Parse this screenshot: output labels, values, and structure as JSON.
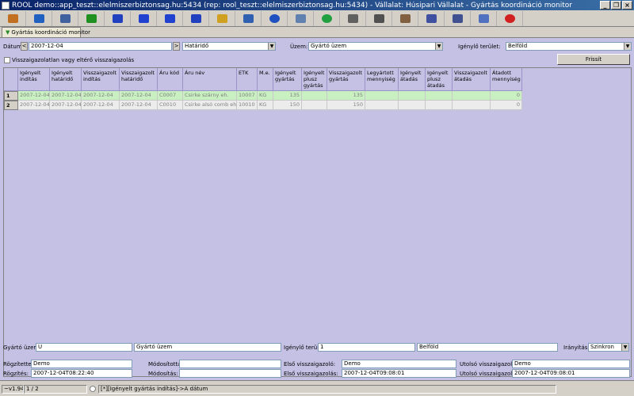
{
  "window": {
    "title": "ROOL demo::app_teszt::elelmiszerbiztonsag.hu:5434 (rep: rool_teszt::elelmiszerbiztonsag.hu:5434) - Vállalat: Húsipari Vállalat - Gyártás koordináció monitor"
  },
  "toolbar": {
    "icons": [
      "edit-icon",
      "open-icon",
      "save-icon",
      "refresh-icon",
      "first-icon",
      "prev-icon",
      "next-icon",
      "last-icon",
      "note-icon",
      "export-icon",
      "info-icon",
      "calendar-icon",
      "reload-icon",
      "search-icon",
      "table-icon",
      "print-icon",
      "grid-icon",
      "columns-icon",
      "window-icon",
      "close-icon"
    ],
    "colors": [
      "#c07020",
      "#2060c0",
      "#4060a0",
      "#209020",
      "#2040c0",
      "#2040d0",
      "#2040d0",
      "#2040c0",
      "#d0a020",
      "#3060b0",
      "#2050c0",
      "#6080b0",
      "#20a040",
      "#606060",
      "#505050",
      "#806040",
      "#4050a0",
      "#405090",
      "#5070c0",
      "#d02020"
    ]
  },
  "tab": {
    "label": "Gyártás koordináció monitor"
  },
  "filters": {
    "date_label": "Dátum:",
    "date_value": "2007-12-04",
    "date_prev": "<",
    "date_next": ">",
    "deadline_select": "Határidő",
    "plant_label": "Üzem:",
    "plant_select": "Gyártó üzem",
    "area_label": "Igénylő terület:",
    "area_select": "Belföld",
    "checkbox_label": "Visszaigazolatlan vagy eltérő visszaigazolás",
    "refresh_button": "Frissít"
  },
  "grid": {
    "columns": [
      "Igényelt indítás",
      "Igényelt határidő",
      "Visszaigazolt indítás",
      "Visszaigazolt határidő",
      "Áru kód",
      "Áru név",
      "ETK",
      "M.e.",
      "Igényelt gyártás",
      "Igényelt plusz gyártás",
      "Visszaigazolt gyártás",
      "Legyártott mennyiség",
      "Igényelt átadás",
      "Igényelt plusz átadás",
      "Visszaigazolt átadás",
      "Átadott mennyiség"
    ],
    "rows": [
      {
        "num": "1",
        "cells": [
          "2007-12-04",
          "2007-12-04",
          "2007-12-04",
          "2007-12-04",
          "C0007",
          "Csirke szárny eh.",
          "10007",
          "KG",
          "135",
          "",
          "135",
          "",
          "",
          "",
          "",
          "0"
        ]
      },
      {
        "num": "2",
        "cells": [
          "2007-12-04",
          "2007-12-04",
          "2007-12-04",
          "2007-12-04",
          "C0010",
          "Csirke alsó comb eh.",
          "10010",
          "KG",
          "150",
          "",
          "150",
          "",
          "",
          "",
          "",
          "0"
        ]
      }
    ]
  },
  "details": {
    "plant_label": "Gyártó üzem:",
    "plant_code": "U",
    "plant_name": "Gyártó üzem",
    "area_label": "Igénylő terület:",
    "area_code": "1",
    "area_name": "Belföld",
    "direction_label": "Irányítás:",
    "direction_value": "Szinkron",
    "recorded_by_label": "Rögzítette:",
    "recorded_by": "Demo",
    "modified_by_label": "Módosította:",
    "modified_by": "",
    "first_confirmer_label": "Első visszaigazoló:",
    "first_confirmer": "Demo",
    "last_confirmer_label": "Utolsó visszaigazoló:",
    "last_confirmer": "Demo",
    "recorded_at_label": "Rögzítés:",
    "recorded_at": "2007-12-04T08:22:40",
    "modified_at_label": "Módosítás:",
    "modified_at": "",
    "first_confirm_label": "Első visszaigazolás:",
    "first_confirm": "2007-12-04T09:08:01",
    "last_confirm_label": "Utolsó visszaigazolás:",
    "last_confirm": "2007-12-04T09:08:01"
  },
  "status": {
    "version": "~v1.94H",
    "position": "1 / 2",
    "sort": "[*][Igényelt gyártás indítás]->A dátum"
  }
}
